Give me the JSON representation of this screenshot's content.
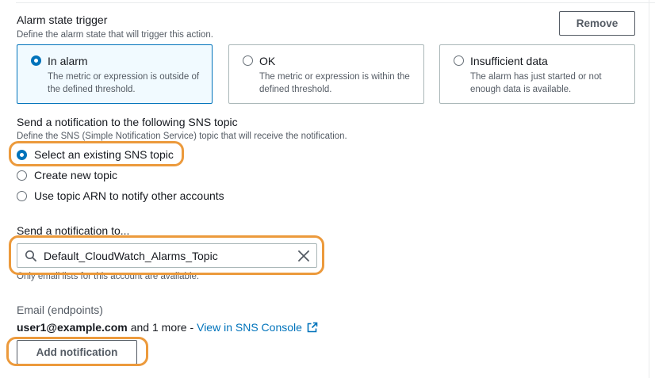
{
  "alarm_trigger": {
    "title": "Alarm state trigger",
    "description": "Define the alarm state that will trigger this action.",
    "remove_label": "Remove",
    "options": [
      {
        "label": "In alarm",
        "description": "The metric or expression is outside of the defined threshold.",
        "selected": true
      },
      {
        "label": "OK",
        "description": "The metric or expression is within the defined threshold.",
        "selected": false
      },
      {
        "label": "Insufficient data",
        "description": "The alarm has just started or not enough data is available.",
        "selected": false
      }
    ]
  },
  "sns": {
    "title": "Send a notification to the following SNS topic",
    "description": "Define the SNS (Simple Notification Service) topic that will receive the notification.",
    "options": [
      {
        "label": "Select an existing SNS topic",
        "selected": true
      },
      {
        "label": "Create new topic",
        "selected": false
      },
      {
        "label": "Use topic ARN to notify other accounts",
        "selected": false
      }
    ]
  },
  "send_to": {
    "label": "Send a notification to...",
    "value": "Default_CloudWatch_Alarms_Topic",
    "hint": "Only email lists for this account are available."
  },
  "endpoints": {
    "label": "Email (endpoints)",
    "email": "user1@example.com",
    "more": "and 1 more -",
    "link": "View in SNS Console"
  },
  "add_notification_label": "Add notification",
  "colors": {
    "accent": "#0073bb",
    "highlight": "#ec9a3c",
    "selected_tile_bg": "#f1faff",
    "text": "#16191f",
    "muted": "#545b64"
  }
}
